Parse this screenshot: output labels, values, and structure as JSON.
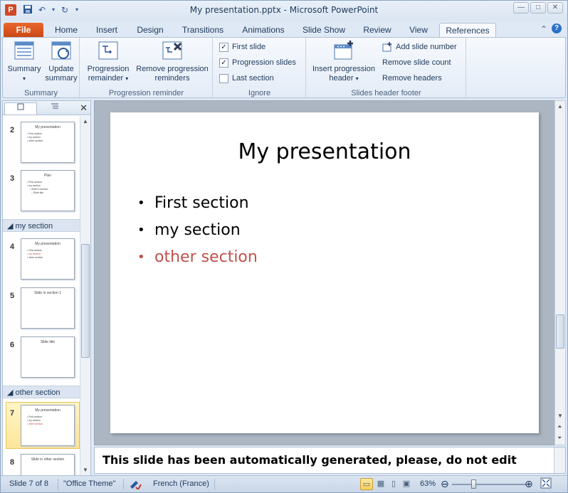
{
  "window": {
    "title": "My presentation.pptx - Microsoft PowerPoint",
    "app_icon": "P"
  },
  "tabs": {
    "file": "File",
    "home": "Home",
    "insert": "Insert",
    "design": "Design",
    "transitions": "Transitions",
    "animations": "Animations",
    "slideshow": "Slide Show",
    "review": "Review",
    "view": "View",
    "references": "References"
  },
  "ribbon": {
    "summary_group": {
      "label": "Summary",
      "summary_btn": "Summary",
      "update_btn_line1": "Update",
      "update_btn_line2": "summary"
    },
    "progression_group": {
      "label": "Progression reminder",
      "remainder_line1": "Progression",
      "remainder_line2": "remainder",
      "remove_line1": "Remove progression",
      "remove_line2": "reminders"
    },
    "ignore_group": {
      "label": "Ignore",
      "first_slide": "First slide",
      "progression_slides": "Progression slides",
      "last_section": "Last section"
    },
    "header_group": {
      "label": "Slides header  footer",
      "insert_line1": "Insert progression",
      "insert_line2": "header",
      "add_slide_number": "Add slide number",
      "remove_slide_count": "Remove slide count",
      "remove_headers": "Remove headers"
    }
  },
  "left_panel": {
    "sections": [
      "my section",
      "other section"
    ],
    "slides": [
      {
        "num": "2",
        "title": "My presentation",
        "lines": [
          "First section",
          "my section",
          "other section"
        ]
      },
      {
        "num": "3",
        "title": "Plan",
        "lines": [
          "First section",
          "my section",
          "Slide in section",
          "Slide title"
        ]
      },
      {
        "num": "4",
        "title": "My presentation",
        "lines": [
          "First section",
          "my section",
          "other section"
        ]
      },
      {
        "num": "5",
        "title": "Slide in section 1",
        "lines": []
      },
      {
        "num": "6",
        "title": "Slide title",
        "lines": []
      },
      {
        "num": "7",
        "title": "My presentation",
        "lines": [
          "First section",
          "my section",
          "other section"
        ]
      },
      {
        "num": "8",
        "title": "Slide in other section",
        "lines": []
      }
    ]
  },
  "slide": {
    "title": "My presentation",
    "bullets": [
      "First section",
      "my section",
      "other section"
    ]
  },
  "notes": {
    "text": "This slide has been automatically generated, please, do not edit"
  },
  "status": {
    "slide_position": "Slide 7 of 8",
    "theme": "\"Office Theme\"",
    "language": "French (France)",
    "zoom": "63%"
  },
  "colors": {
    "accent_red": "#c0504d",
    "file_tab": "#d24726"
  }
}
